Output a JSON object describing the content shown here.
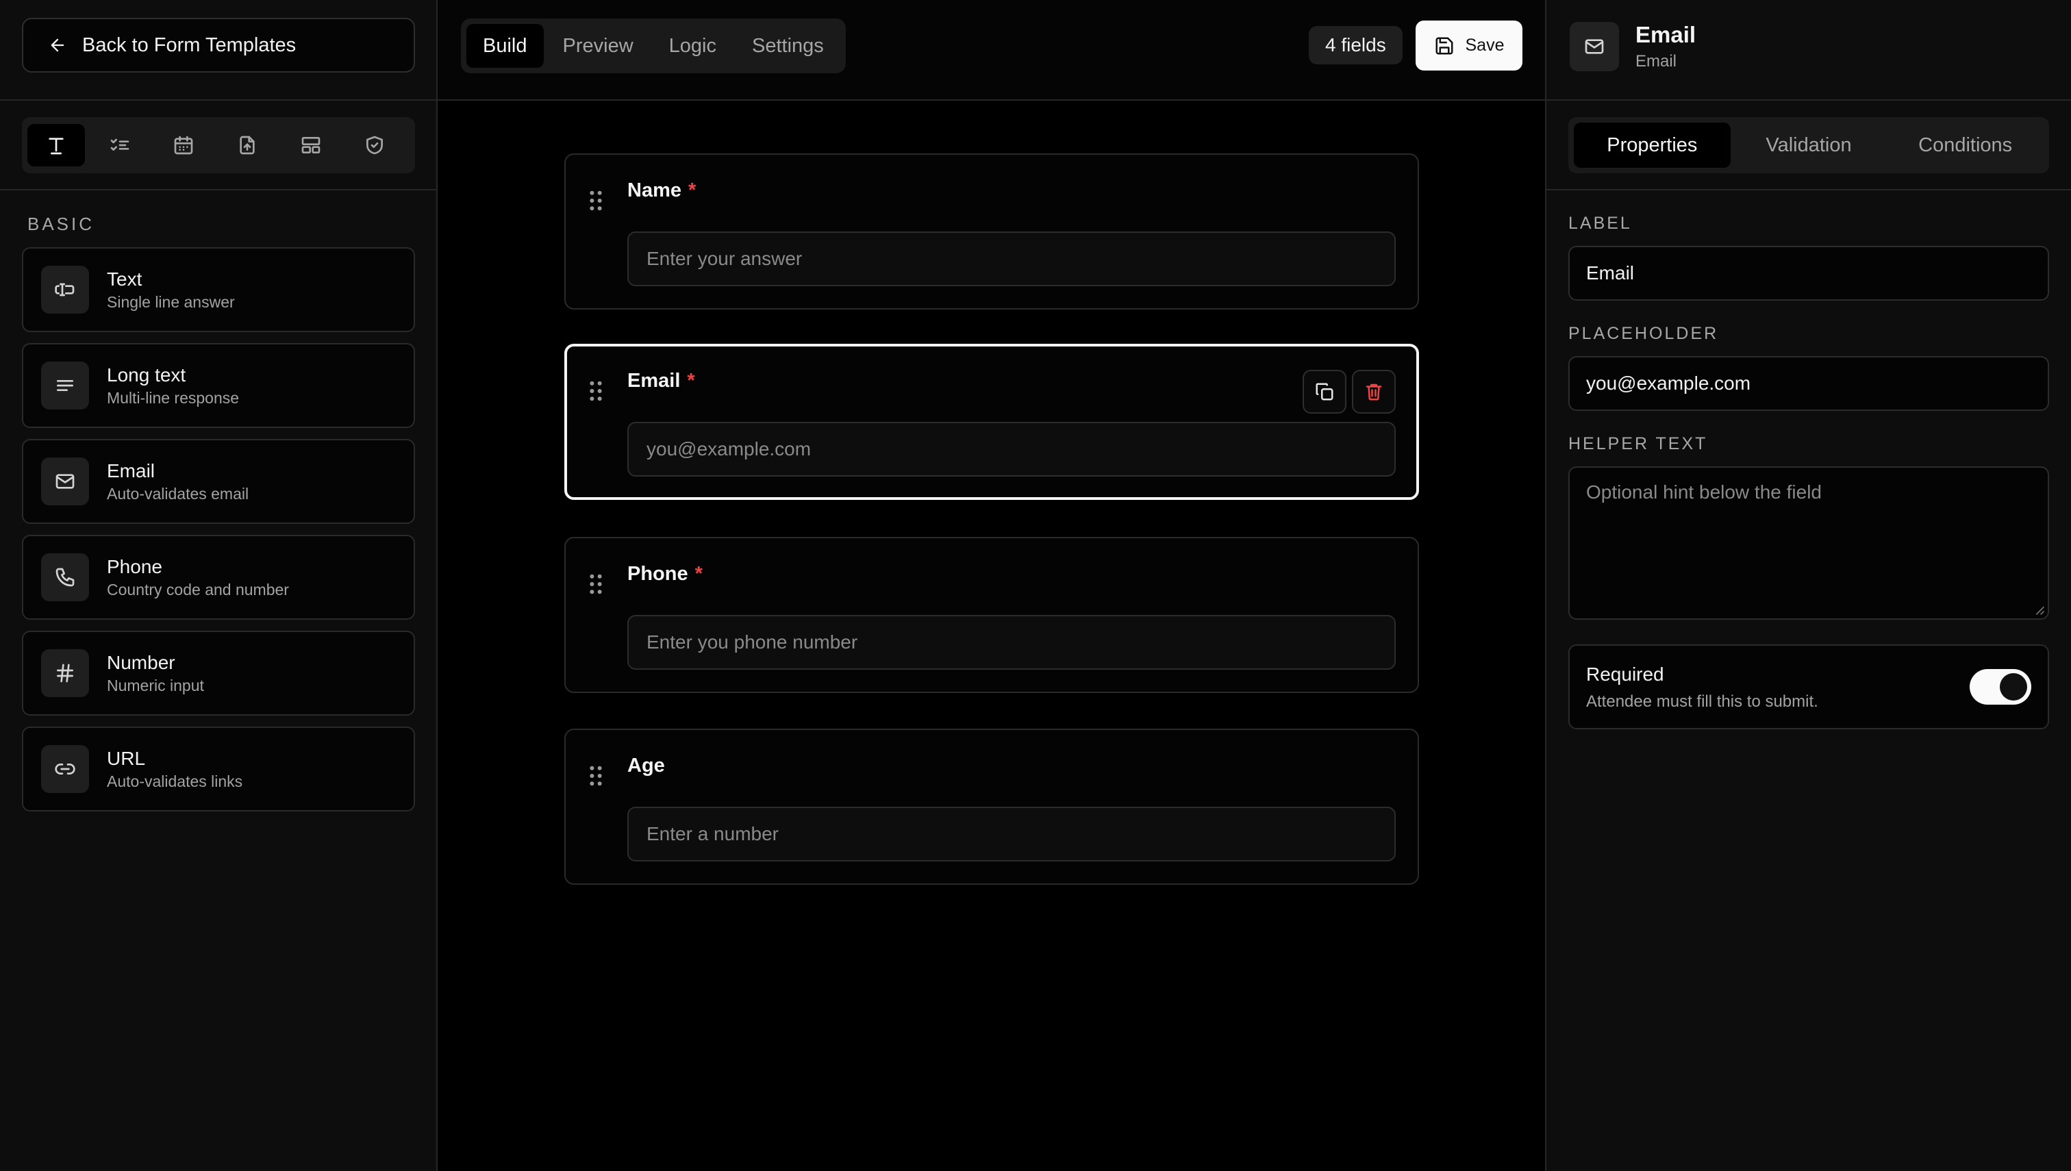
{
  "left_sidebar": {
    "back_label": "Back to Form Templates",
    "categories": [
      "text-category-icon",
      "checklist-category-icon",
      "calendar-category-icon",
      "file-upload-category-icon",
      "layout-category-icon",
      "shield-category-icon"
    ],
    "section_title": "BASIC",
    "fields": [
      {
        "title": "Text",
        "subtitle": "Single line answer",
        "icon": "text-cursor-icon"
      },
      {
        "title": "Long text",
        "subtitle": "Multi-line response",
        "icon": "lines-icon"
      },
      {
        "title": "Email",
        "subtitle": "Auto-validates email",
        "icon": "mail-icon"
      },
      {
        "title": "Phone",
        "subtitle": "Country code and number",
        "icon": "phone-icon"
      },
      {
        "title": "Number",
        "subtitle": "Numeric input",
        "icon": "hash-icon"
      },
      {
        "title": "URL",
        "subtitle": "Auto-validates links",
        "icon": "link-icon"
      }
    ]
  },
  "toolbar": {
    "tabs": [
      "Build",
      "Preview",
      "Logic",
      "Settings"
    ],
    "active_tab": "Build",
    "field_count": "4 fields",
    "save_label": "Save"
  },
  "form": {
    "fields": [
      {
        "label": "Name",
        "required_mark": "*",
        "placeholder": "Enter your answer"
      },
      {
        "label": "Email",
        "required_mark": "*",
        "placeholder": "you@example.com",
        "selected": true
      },
      {
        "label": "Phone",
        "required_mark": "*",
        "placeholder": "Enter you phone number"
      },
      {
        "label": "Age",
        "required_mark": "",
        "placeholder": "Enter a number"
      }
    ]
  },
  "properties": {
    "header_title": "Email",
    "header_subtitle": "Email",
    "tabs": [
      "Properties",
      "Validation",
      "Conditions"
    ],
    "active_tab": "Properties",
    "label_heading": "LABEL",
    "label_value": "Email",
    "placeholder_heading": "PLACEHOLDER",
    "placeholder_value": "you@example.com",
    "helper_heading": "HELPER TEXT",
    "helper_placeholder": "Optional hint below the field",
    "required_title": "Required",
    "required_subtitle": "Attendee must fill this to submit.",
    "required_on": true
  },
  "colors": {
    "background": "#000000",
    "panel": "#0d0d0d",
    "required_asterisk": "#ef4444",
    "delete_icon": "#ef4444",
    "accent_white": "#fafafa"
  }
}
